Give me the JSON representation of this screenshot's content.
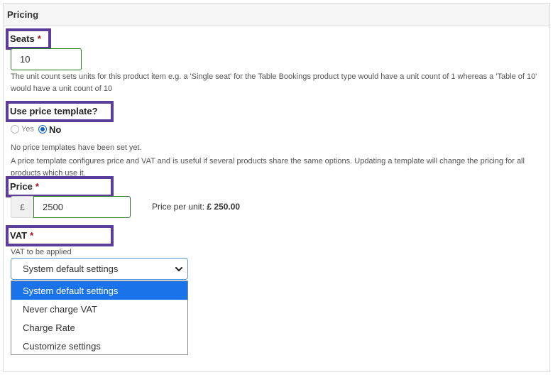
{
  "panel": {
    "title": "Pricing"
  },
  "seats": {
    "label": "Seats",
    "required_mark": "*",
    "value": "10",
    "help": "The unit count sets units for this product item e.g. a 'Single seat' for the Table Bookings product type would have a unit count of 1 whereas a 'Table of 10' would have a unit count of 10"
  },
  "template": {
    "label": "Use price template?",
    "options": {
      "yes": "Yes",
      "no": "No"
    },
    "selected": "No",
    "none_note": "No price templates have been set yet.",
    "help": "A price template configures price and VAT and is useful if several products share the same options. Updating a template will change the pricing for all products which use it."
  },
  "price": {
    "label": "Price",
    "required_mark": "*",
    "currency": "£",
    "value": "2500",
    "per_unit_label": "Price per unit:",
    "per_unit_value": "£ 250.00"
  },
  "vat": {
    "label": "VAT",
    "required_mark": "*",
    "help": "VAT to be applied",
    "selected": "System default settings",
    "options": [
      "System default settings",
      "Never charge VAT",
      "Charge Rate",
      "Customize settings"
    ]
  },
  "colors": {
    "highlight_border": "#5b3e99",
    "input_border": "#2f7a2f",
    "selected_option": "#1a73e8",
    "required": "#a50e0e"
  }
}
